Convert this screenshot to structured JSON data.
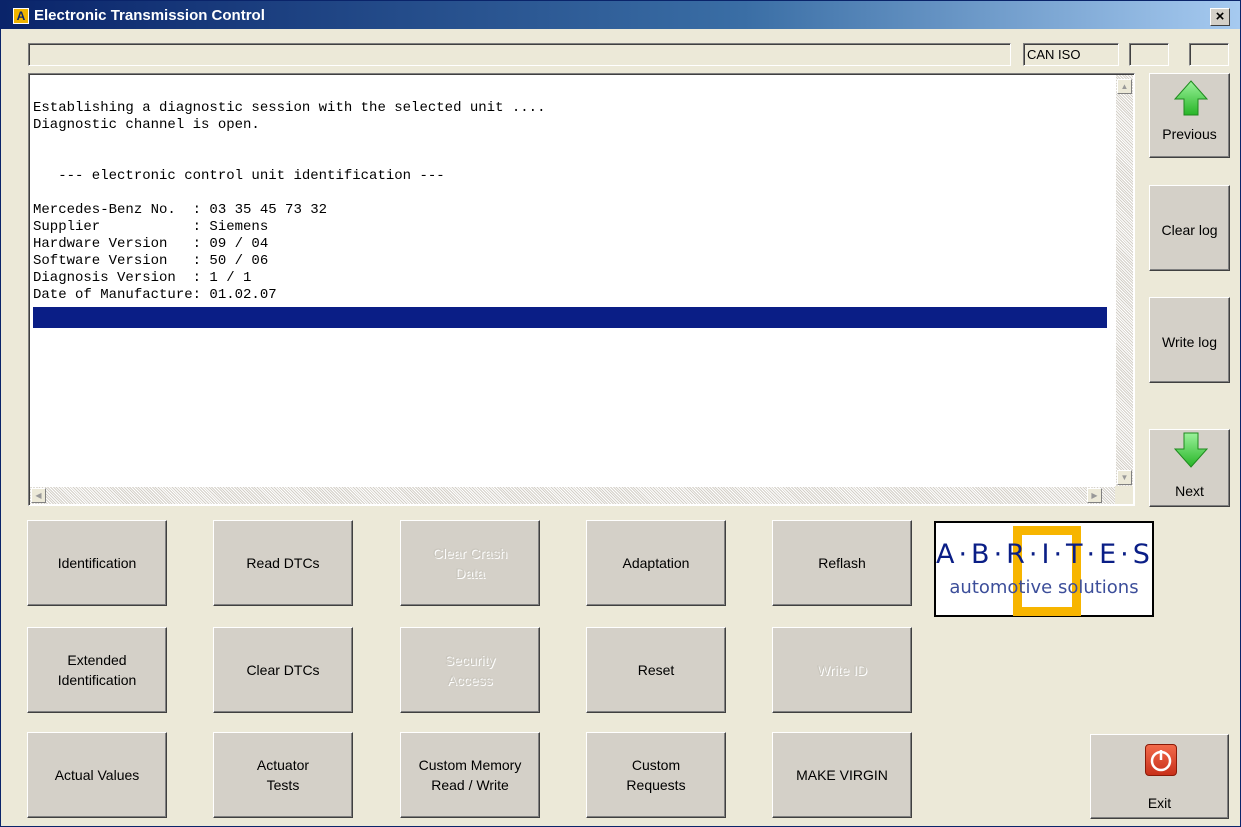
{
  "window": {
    "title": "Electronic Transmission Control",
    "icon_letter": "A",
    "close_label": "×"
  },
  "status": {
    "message": "",
    "protocol": "CAN ISO",
    "field_a": "",
    "field_b": ""
  },
  "log": {
    "lines": [
      "Establishing a diagnostic session with the selected unit ....",
      "Diagnostic channel is open.",
      "",
      "",
      "   --- electronic control unit identification ---",
      "",
      "Mercedes-Benz No.  : 03 35 45 73 32",
      "Supplier           : Siemens",
      "Hardware Version   : 09 / 04",
      "Software Version   : 50 / 06",
      "Diagnosis Version  : 1 / 1",
      "Date of Manufacture: 01.02.07"
    ],
    "selected_line": ""
  },
  "nav": {
    "previous": "Previous",
    "clear_log": "Clear log",
    "write_log": "Write log",
    "next": "Next"
  },
  "functions": {
    "identification": "Identification",
    "read_dtcs": "Read DTCs",
    "clear_crash_data": "Clear Crash\nData",
    "adaptation": "Adaptation",
    "reflash": "Reflash",
    "extended_identification": "Extended\nIdentification",
    "clear_dtcs": "Clear DTCs",
    "security_access": "Security\nAccess",
    "reset": "Reset",
    "write_id": "Write ID",
    "actual_values": "Actual Values",
    "actuator_tests": "Actuator\nTests",
    "custom_memory": "Custom Memory\nRead / Write",
    "custom_requests": "Custom\nRequests",
    "make_virgin": "MAKE VIRGIN"
  },
  "logo": {
    "word": "A·B·R·I·T·E·S",
    "tagline": "automotive solutions"
  },
  "exit": {
    "label": "Exit"
  },
  "colors": {
    "title_bar": "#0a246a",
    "selection": "#0a1e86",
    "logo_accent": "#f7b500",
    "arrow_green": "#3cc83c",
    "exit_red": "#d8401f"
  }
}
